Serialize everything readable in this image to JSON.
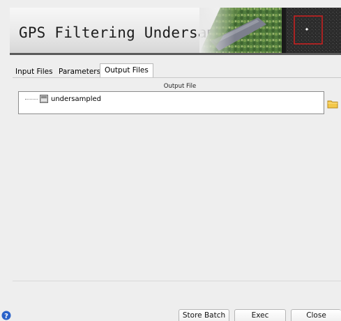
{
  "header": {
    "title": "GPS Filtering Undersampling",
    "banner_image": "aerial-landscape-image"
  },
  "tabs": [
    {
      "label": "Input Files",
      "active": false
    },
    {
      "label": "Parameters",
      "active": false
    },
    {
      "label": "Output Files",
      "active": true
    }
  ],
  "output": {
    "column_header": "Output File",
    "items": [
      {
        "label": "undersampled",
        "icon": "file-icon"
      }
    ],
    "browse_icon": "folder-icon"
  },
  "footer": {
    "help_icon": "help-icon",
    "store_batch_label": "Store Batch",
    "exec_label": "Exec",
    "close_label": "Close"
  },
  "colors": {
    "background": "#eeeeee",
    "help_blue": "#2a62c9",
    "folder_yellow": "#f3c84a",
    "banner_rule": "#5a5a5a"
  }
}
